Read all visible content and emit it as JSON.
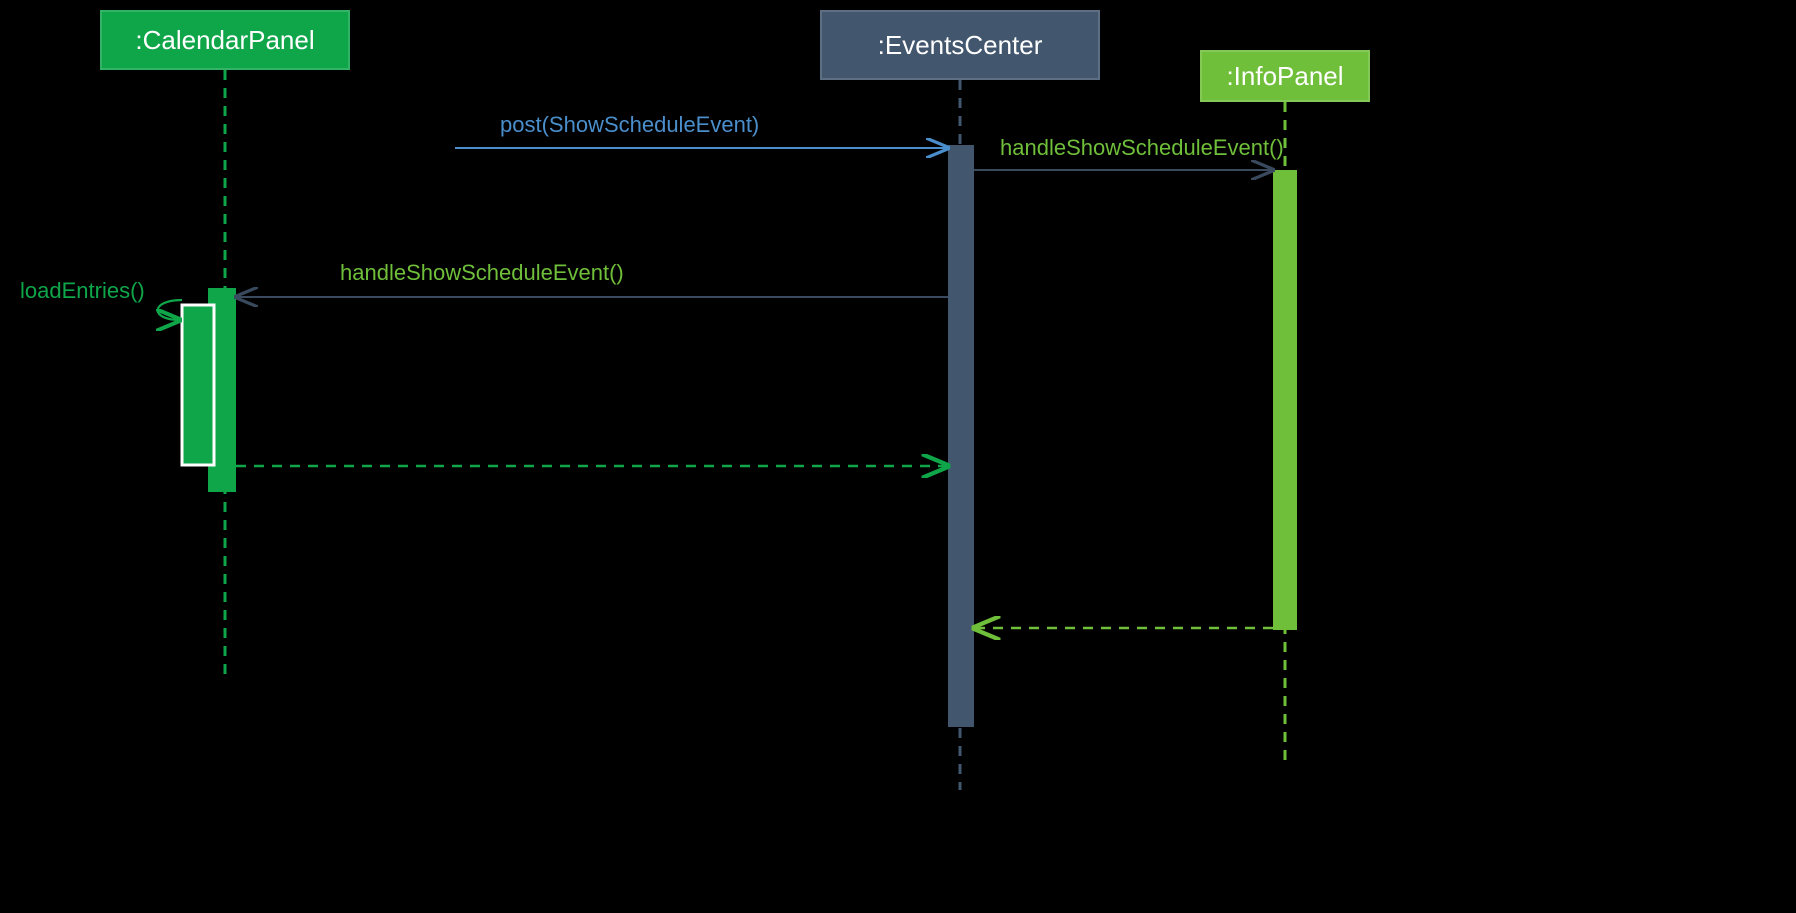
{
  "diagram": {
    "type": "uml-sequence",
    "participants": {
      "calendar": {
        "label": ":CalendarPanel",
        "color": "#0fa64a",
        "text": "#ffffff"
      },
      "events": {
        "label": ":EventsCenter",
        "color": "#42566e",
        "text": "#ffffff"
      },
      "info": {
        "label": ":InfoPanel",
        "color": "#6fbf3a",
        "text": "#ffffff"
      }
    },
    "messages": {
      "post": {
        "label": "post(ShowScheduleEvent)",
        "color": "#4a8ecb"
      },
      "handleToInfo": {
        "label": "handleShowScheduleEvent()",
        "color": "#6fbf3a"
      },
      "handleToCal": {
        "label": "handleShowScheduleEvent()",
        "color": "#6fbf3a"
      },
      "loadEntries": {
        "label": "loadEntries()",
        "color": "#0fa64a"
      },
      "returnCalToEv": {
        "label": "",
        "color": "#0fa64a"
      },
      "returnInfoToEv": {
        "label": "",
        "color": "#6fbf3a"
      }
    }
  }
}
